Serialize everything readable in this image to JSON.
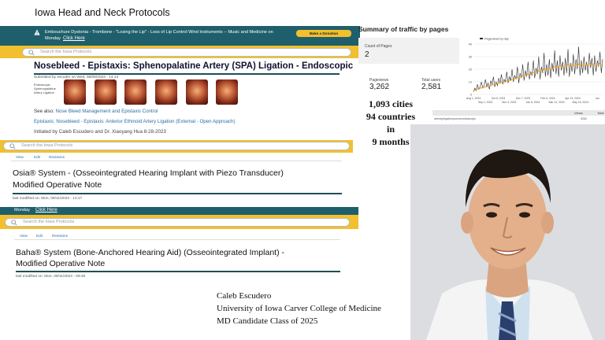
{
  "slide": {
    "title": "Iowa Head and Neck Protocols"
  },
  "shot1": {
    "banner_text": "Embouchure Dystonia - Trombone - \"Losing the Lip\" - Loss of Lip Control Wind Instruments -- Music and Medicine on Monday",
    "banner_link": "Click Here",
    "donate_label": "Make a Donation",
    "search_placeholder": "Search the Iowa Protocols",
    "page_title": "Nosebleed - Epistaxis: Sphenopalatine Artery (SPA) Ligation - Endoscopic",
    "submitted": "Submitted by escuder on Wed, 08/09/2023 - 14:13",
    "thumb_caption": "Endoscopic Sphenopalatine Artery Ligation",
    "see_also_prefix": "See also:",
    "see_also_link": "Nose Bleed Management and Epistaxis Control",
    "related_link": "Epistaxis; Nosebleed - Epistaxis: Anterior Ethmoid Artery Ligation (External - Open Approach)",
    "initiated": "Initiated by Caleb Escudero and Dr. Xiaoyang Hua 8-28-2023"
  },
  "shot2": {
    "search_placeholder": "Search the Iowa Protocols",
    "tabs": [
      "View",
      "Edit",
      "Revisions"
    ],
    "title_line1": "Osia® System - (Osseointegrated Hearing Implant with Piezo Transducer)",
    "title_line2": "Modified Operative Note",
    "last_modified": "last modified on: Mon, 09/11/2023 - 13:17"
  },
  "shot3": {
    "banner_fragment": "Monday",
    "banner_link": "Click Here",
    "search_placeholder": "Search the Iowa Protocols",
    "tabs": [
      "View",
      "Edit",
      "Revisions"
    ],
    "title_line1": "Baha® System (Bone-Anchored Hearing Aid) (Osseointegrated Implant) -",
    "title_line2": "Modified Operative Note",
    "last_modified": "last modified on: Mon, 09/11/2023 - 09:48"
  },
  "analytics": {
    "title": "Summary of traffic by pages",
    "count_label": "Count of Pages",
    "count_value": "2",
    "pageviews_label": "Pageviews",
    "pageviews_value": "3,262",
    "users_label": "Total users",
    "users_value": "2,581",
    "table_views_header": "Views",
    "table_total_header": "Total",
    "table_row_page": "arterepiegatomysomenodoscopic",
    "table_row_views": "5262"
  },
  "chart_data": {
    "type": "line",
    "title": "",
    "legend": "Pageviews by day",
    "ylim": [
      0,
      40
    ],
    "yticks": [
      0,
      10,
      20,
      30,
      40
    ],
    "xticks_top": [
      "Aug 1, 2023",
      "Oct 8, 2023",
      "Dec 7, 2023",
      "Feb 5, 2024",
      "Apr 13, 2024",
      "Jun"
    ],
    "xticks_bottom": [
      "Sep 2, 2023",
      "Nov 3, 2023",
      "Jan 6, 2024",
      "Mar 12, 2024",
      "May 15, 2024"
    ],
    "series_color": "#2b2b2b",
    "trend_color": "#f2a020",
    "series": [
      {
        "values": [
          2,
          5,
          3,
          8,
          4,
          6,
          10,
          5,
          7,
          12,
          6,
          9,
          4,
          11,
          8,
          14,
          6,
          10,
          7,
          13,
          9,
          16,
          8,
          12,
          10,
          18,
          9,
          14,
          11,
          20,
          10,
          15,
          12,
          22,
          9,
          17,
          13,
          24,
          11,
          19,
          14,
          26,
          12,
          18,
          15,
          27,
          13,
          21,
          16,
          30,
          12,
          22,
          17,
          33,
          14,
          24,
          15,
          28,
          13,
          25,
          18,
          35,
          16,
          27,
          14,
          31,
          19,
          26,
          15,
          29,
          17,
          36,
          14,
          25,
          18,
          32,
          16,
          28,
          20,
          38,
          15,
          27,
          17,
          30,
          19,
          26,
          16,
          33,
          21,
          29,
          15,
          31,
          18,
          27,
          22,
          34,
          17,
          28
        ]
      }
    ]
  },
  "big_stats": {
    "cities": "1,093 cities",
    "countries": "94 countries",
    "in": "in",
    "months": "9 months"
  },
  "caption": {
    "name": "Caleb Escudero",
    "school": "University of Iowa Carver College of Medicine",
    "class": "MD Candidate Class of 2025"
  },
  "colors": {
    "banner": "#1f5f6b",
    "accent_yellow": "#f2c02e",
    "link": "#2a6fa8"
  }
}
